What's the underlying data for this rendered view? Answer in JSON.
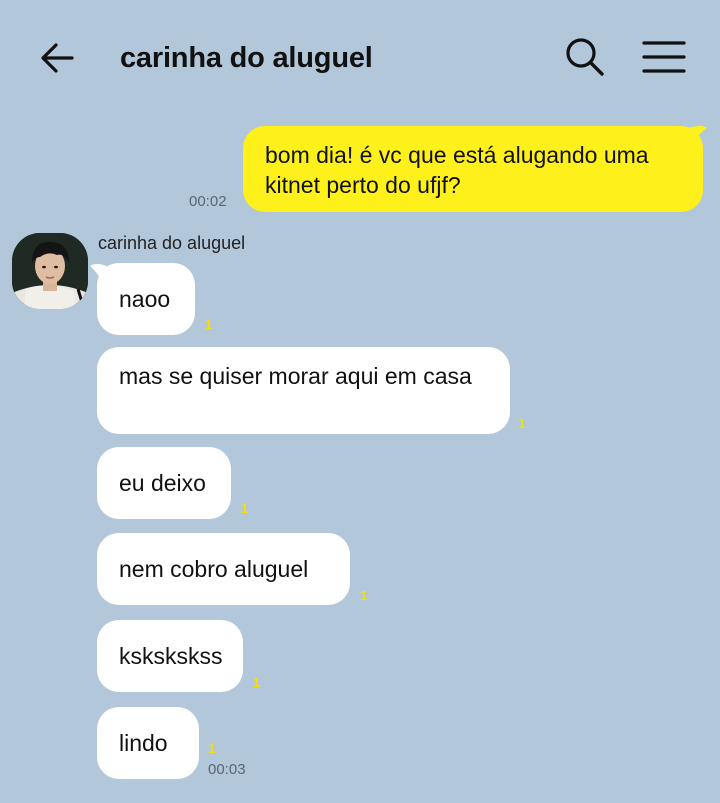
{
  "header": {
    "title": "carinha do aluguel"
  },
  "icons": {
    "back": "arrow-left-icon",
    "search": "search-icon",
    "menu": "hamburger-menu-icon"
  },
  "colors": {
    "background": "#b2c7da",
    "my_bubble": "#fef01b",
    "their_bubble": "#ffffff",
    "unread": "#f5e000"
  },
  "messages": {
    "m0": {
      "text": "bom dia! é vc que está alugando uma kitnet perto do ufjf?",
      "time": "00:02"
    },
    "sender_name": "carinha do aluguel",
    "m1": {
      "text": "naoo",
      "unread": "1"
    },
    "m2": {
      "text": "mas se quiser morar aqui em casa",
      "unread": "1"
    },
    "m3": {
      "text": "eu deixo",
      "unread": "1"
    },
    "m4": {
      "text": "nem cobro aluguel",
      "unread": "1"
    },
    "m5": {
      "text": "kskskskss",
      "unread": "1"
    },
    "m6": {
      "text": "lindo",
      "unread": "1",
      "time": "00:03"
    }
  }
}
